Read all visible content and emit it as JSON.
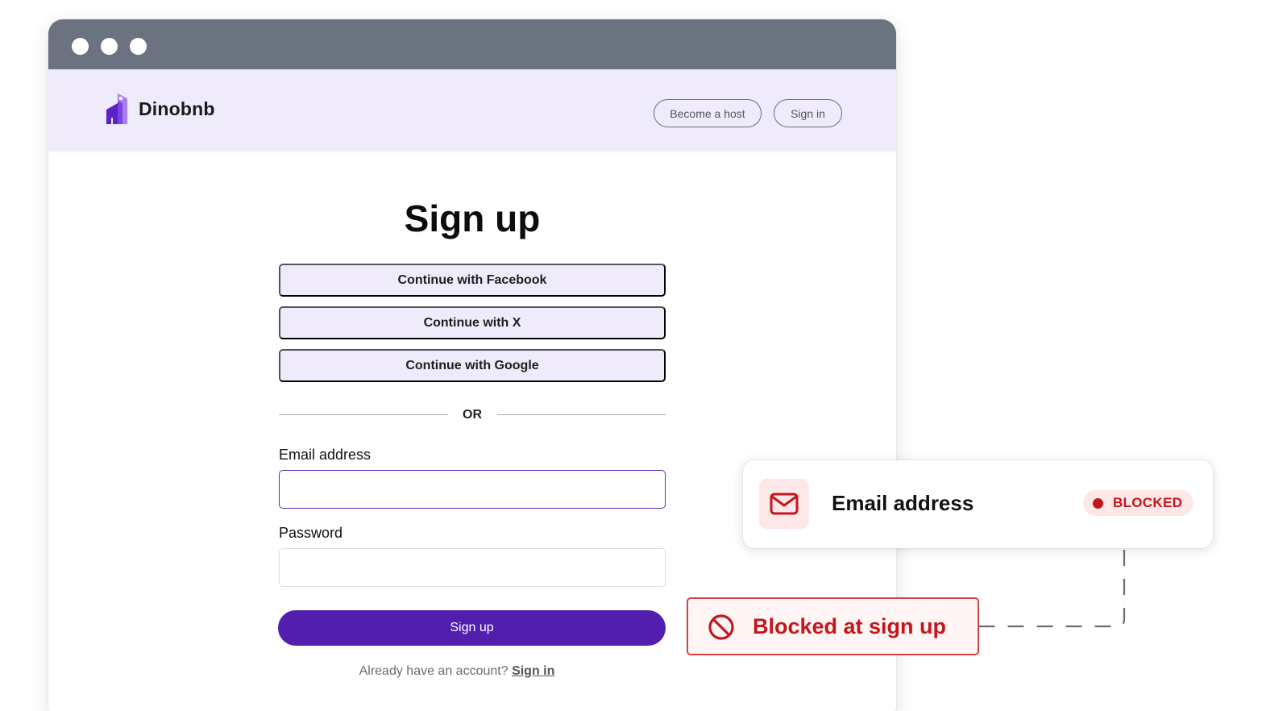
{
  "browser": {
    "window_dots": [
      "close-dot",
      "minimize-dot",
      "maximize-dot"
    ]
  },
  "nav": {
    "brand": "Dinobnb",
    "become_host_label": "Become a host",
    "sign_in_label": "Sign in"
  },
  "signup": {
    "title": "Sign up",
    "social": [
      {
        "label": "Continue with Facebook"
      },
      {
        "label": "Continue with X"
      },
      {
        "label": "Continue with Google"
      }
    ],
    "divider_text": "OR",
    "email_label": "Email address",
    "email_value": "",
    "password_label": "Password",
    "password_value": "",
    "submit_label": "Sign up",
    "already_text": "Already have an account?",
    "sign_in_link": "Sign in"
  },
  "overlay": {
    "card_title": "Email address",
    "badge_text": "BLOCKED",
    "blocked_message": "Blocked at sign up",
    "icons": {
      "card": "mail-icon",
      "blocked": "blocked-icon"
    }
  },
  "colors": {
    "brand_purple": "#521ead",
    "nav_bg": "#efebfb",
    "titlebar": "#6b7280",
    "blocked_red": "#c4161c"
  }
}
